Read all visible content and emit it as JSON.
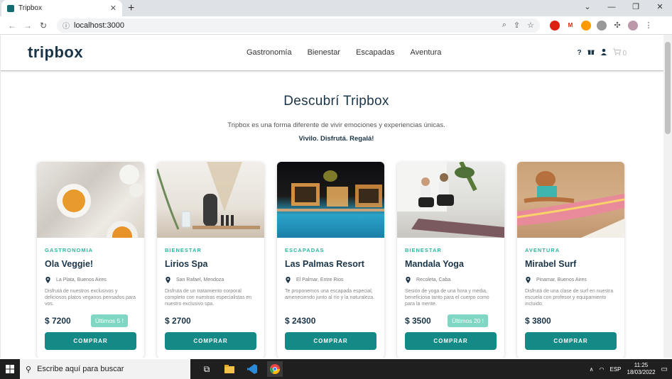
{
  "browser": {
    "tab_title": "Tripbox",
    "new_tab": "+",
    "url": "localhost:3000",
    "window_controls": [
      "⌄",
      "—",
      "❐",
      "✕"
    ]
  },
  "header": {
    "logo": "tripbox",
    "nav": [
      "Gastronomía",
      "Bienestar",
      "Escapadas",
      "Aventura"
    ],
    "cart_count": "0"
  },
  "hero": {
    "title": "Descubrí Tripbox",
    "subtitle": "Tripbox es una forma diferente de vivir emociones y experiencias únicas.",
    "tagline": "Vivilo. Disfrutá. Regalá!"
  },
  "cards": [
    {
      "category": "GASTRONOMIA",
      "name": "Ola Veggie!",
      "location": "La Plata, Buenos Aires",
      "description": "Disfrutá de nuestros exclusivos y deliciosos platos veganos pensados para vos.",
      "price": "$ 7200",
      "badge": "Últimos 5 !",
      "button": "COMPRAR"
    },
    {
      "category": "BIENESTAR",
      "name": "Lirios Spa",
      "location": "San Rafael, Mendoza",
      "description": "Disfruta de un tratamiento corporal completo con nuestras especialistas en nuestro exclusivo spa.",
      "price": "$ 2700",
      "badge": "",
      "button": "COMPRAR"
    },
    {
      "category": "ESCAPADAS",
      "name": "Las Palmas Resort",
      "location": "El Palmar, Entre Rios",
      "description": "Te proponemos una escapada especial, ameneciendo junto al río y la naturaleza.",
      "price": "$ 24300",
      "badge": "",
      "button": "COMPRAR"
    },
    {
      "category": "BIENESTAR",
      "name": "Mandala Yoga",
      "location": "Recoleta, Caba",
      "description": "Sesión de yoga de una hora y media, beneficiosa tanto para el cuerpo como para la mente.",
      "price": "$ 3500",
      "badge": "Últimos 20 !",
      "button": "COMPRAR"
    },
    {
      "category": "AVENTURA",
      "name": "Mirabel Surf",
      "location": "Pinamar, Buenos Aires",
      "description": "Disfrutá de una clase de surf en nuestra escuela con profesor y equipamiento incluido.",
      "price": "$ 3800",
      "badge": "",
      "button": "COMPRAR"
    }
  ],
  "taskbar": {
    "search_placeholder": "Escribe aquí para buscar",
    "lang": "ESP",
    "time": "11:25",
    "date": "18/03/2022"
  },
  "colors": {
    "accent": "#148a86",
    "category": "#2cb5a0",
    "badge": "#7fd6c2",
    "navy": "#1b3548"
  }
}
